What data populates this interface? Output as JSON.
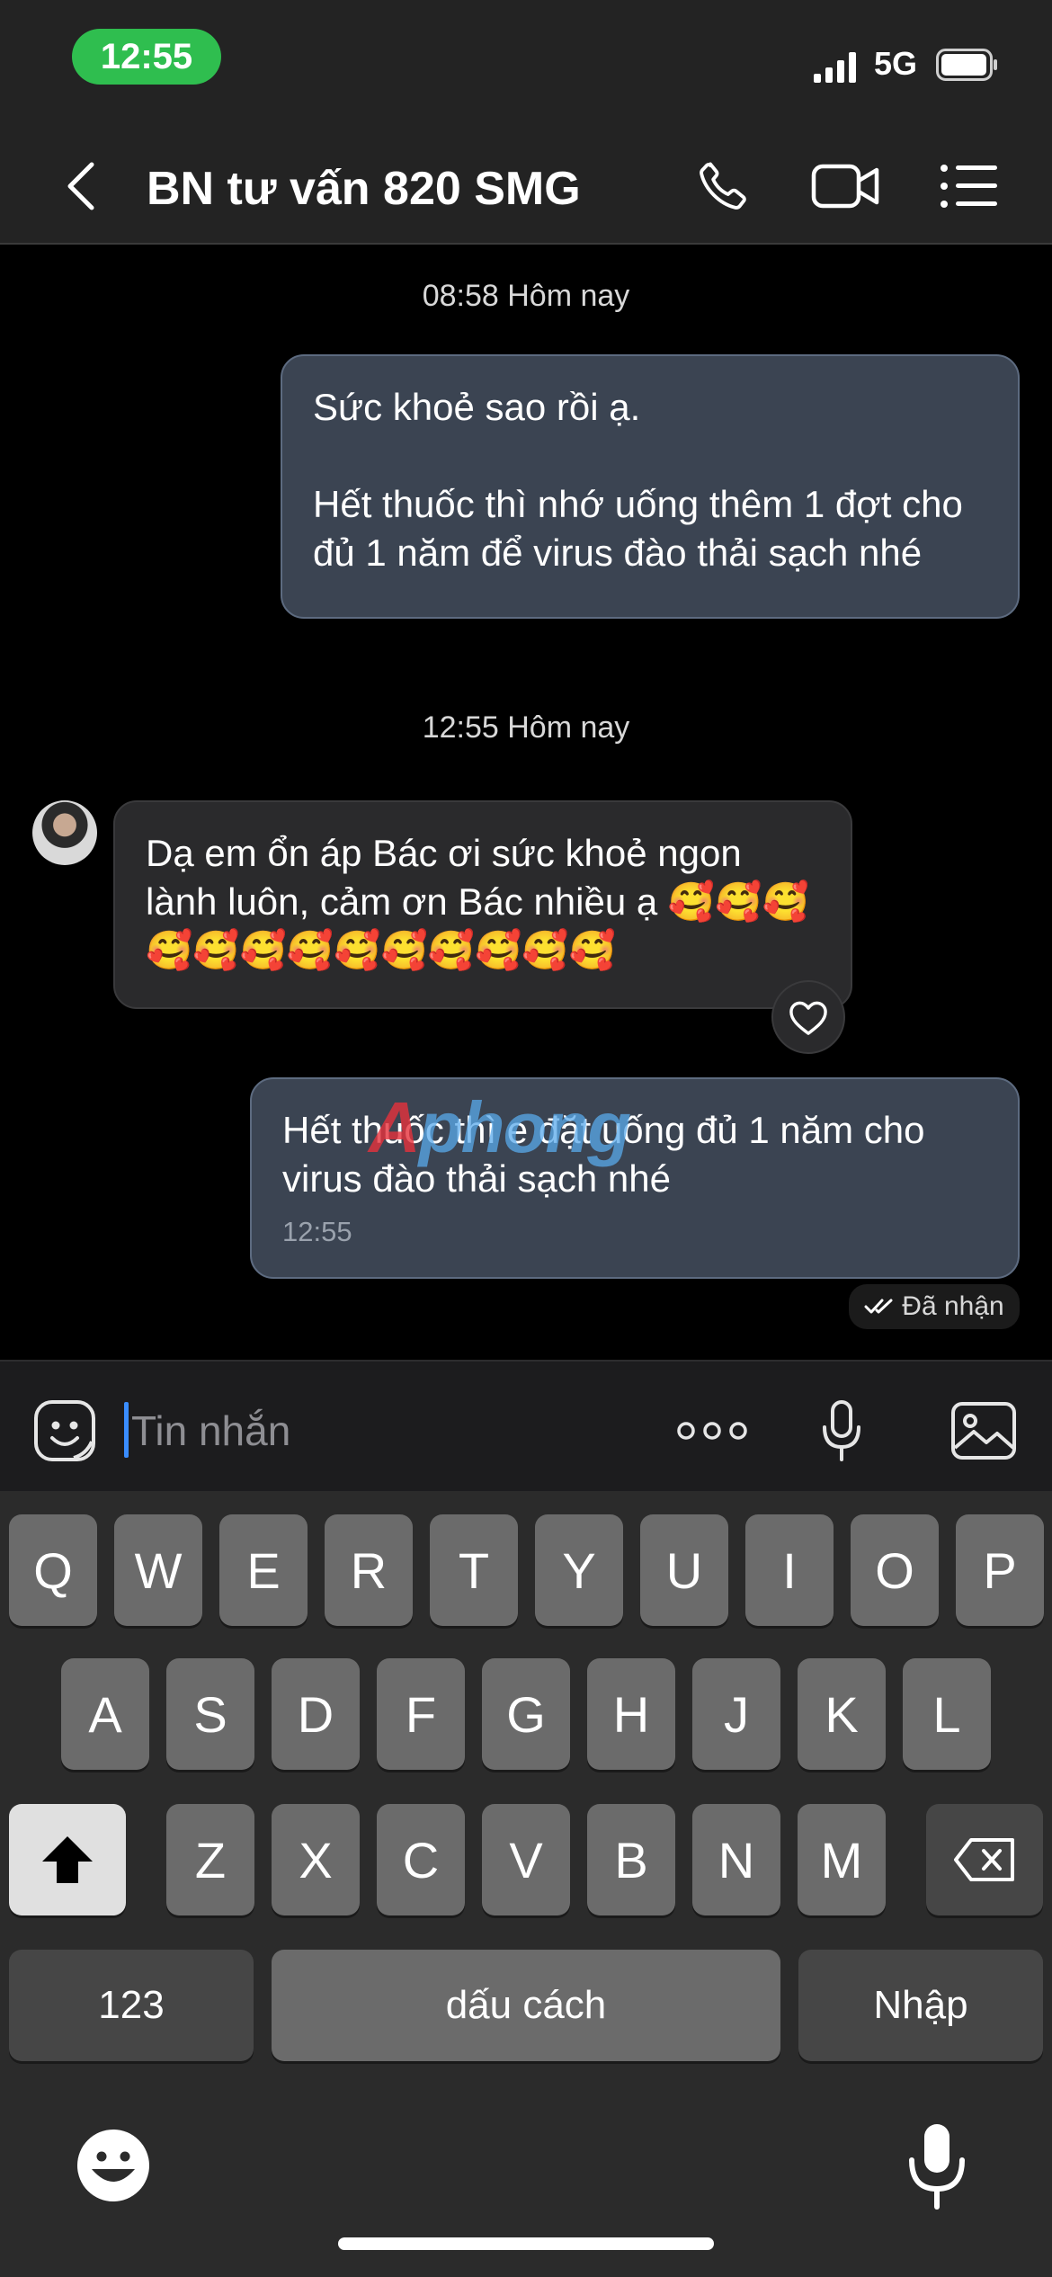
{
  "status": {
    "time": "12:55",
    "network": "5G"
  },
  "header": {
    "title": "BN tư vấn 820 SMG",
    "icons": [
      "back-icon",
      "phone-icon",
      "video-call-icon",
      "menu-list-icon"
    ]
  },
  "chat": {
    "ts1": "08:58 Hôm nay",
    "out1_line1": "Sức khoẻ sao rồi ạ.",
    "out1_line2": "Hết thuốc thì nhớ uống thêm 1 đợt cho đủ 1 năm để virus đào thải sạch nhé",
    "ts2": "12:55 Hôm nay",
    "in1_text": "Dạ em ổn áp Bác ơi sức khoẻ ngon lành luôn, cảm ơn Bác nhiều ạ 🥰🥰🥰🥰🥰🥰🥰🥰🥰🥰🥰🥰🥰",
    "out2_text": "Hết thuốc thì e đặt uống đủ 1 năm cho virus đào thải sạch nhé",
    "out2_time": "12:55",
    "receipt": "Đã nhận",
    "watermark": "phong",
    "watermark_prefix": "A"
  },
  "input": {
    "placeholder": "Tin nhắn",
    "icons": [
      "sticker-icon",
      "more-icon",
      "mic-icon",
      "image-icon"
    ]
  },
  "keyboard": {
    "row1": [
      "Q",
      "W",
      "E",
      "R",
      "T",
      "Y",
      "U",
      "I",
      "O",
      "P"
    ],
    "row2": [
      "A",
      "S",
      "D",
      "F",
      "G",
      "H",
      "J",
      "K",
      "L"
    ],
    "row3": [
      "Z",
      "X",
      "C",
      "V",
      "B",
      "N",
      "M"
    ],
    "numbers": "123",
    "space": "dấu cách",
    "return": "Nhập"
  },
  "colors": {
    "accent": "#2fbe4f",
    "bubble_out": "#3b4452",
    "bubble_in": "#2a2a2c"
  }
}
